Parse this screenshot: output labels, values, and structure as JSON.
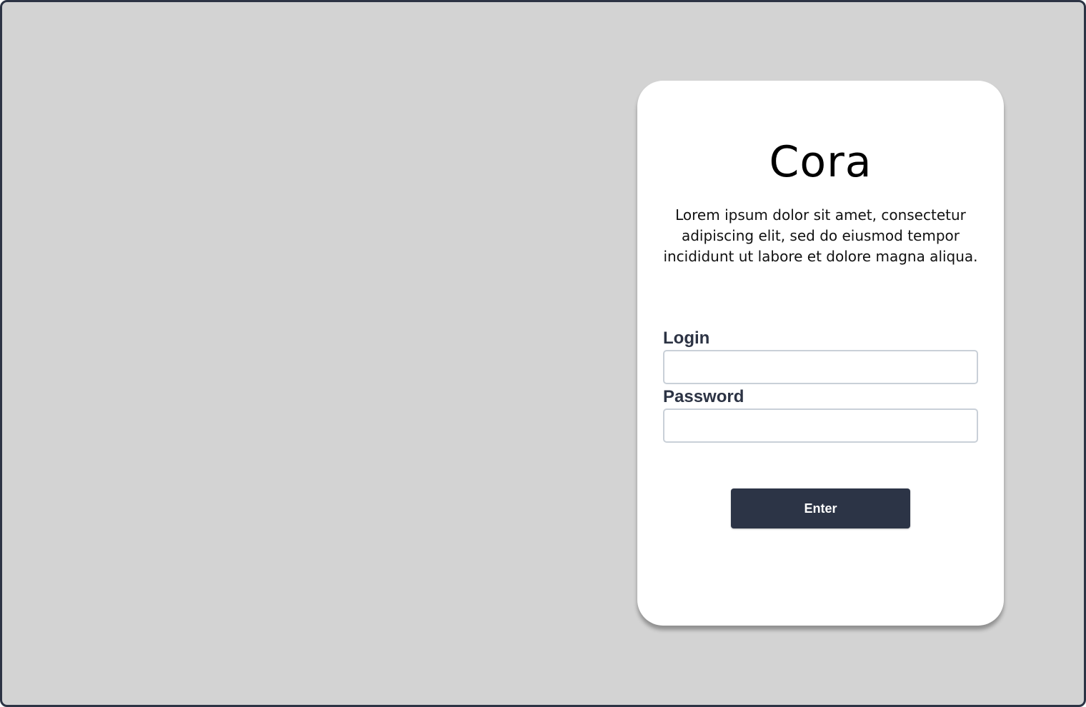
{
  "colors": {
    "background": "#d3d3d3",
    "frame_border": "#2c3344",
    "card": "#ffffff",
    "label_text": "#2c3344",
    "button_bg": "#2c3446",
    "button_text": "#ffffff",
    "field_border": "#c9d0d8"
  },
  "login_card": {
    "title": "Cora",
    "description": "Lorem ipsum dolor sit amet, consectetur adipiscing elit, sed do eiusmod tempor incididunt ut labore et dolore magna aliqua.",
    "login_label": "Login",
    "login_value": "",
    "password_label": "Password",
    "password_value": "",
    "enter_label": "Enter"
  }
}
